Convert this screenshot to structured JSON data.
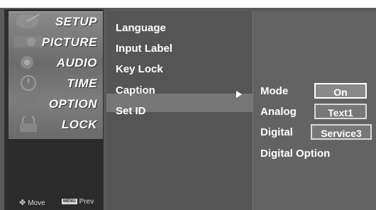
{
  "categories": [
    {
      "label": "SETUP",
      "icon": "satellite-icon"
    },
    {
      "label": "PICTURE",
      "icon": "picture-icon"
    },
    {
      "label": "AUDIO",
      "icon": "speaker-icon"
    },
    {
      "label": "TIME",
      "icon": "clock-icon"
    },
    {
      "label": "OPTION",
      "icon": "option-icon"
    },
    {
      "label": "LOCK",
      "icon": "lock-icon"
    }
  ],
  "hints": {
    "move_label": "Move",
    "menu_key": "MENU",
    "prev_label": "Prev"
  },
  "option_menu": {
    "items": [
      "Language",
      "Input Label",
      "Key Lock",
      "Caption",
      "Set ID"
    ],
    "selected": "Caption"
  },
  "caption_menu": {
    "rows": [
      {
        "label": "Mode",
        "value": "On"
      },
      {
        "label": "Analog",
        "value": "Text1"
      },
      {
        "label": "Digital",
        "value": "Service3"
      },
      {
        "label": "Digital Option",
        "value": ""
      }
    ]
  },
  "colors": {
    "background": "#5a5a5a",
    "highlight": "#777777",
    "text": "#ffffff"
  }
}
